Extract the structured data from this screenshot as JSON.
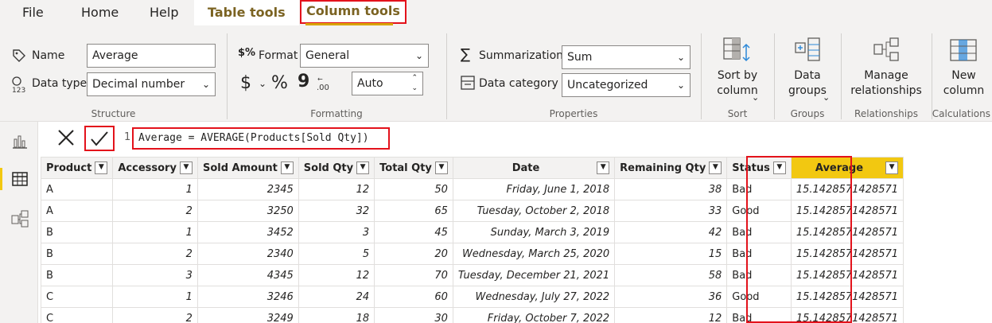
{
  "menu": {
    "file": "File",
    "home": "Home",
    "help": "Help",
    "table_tools": "Table tools",
    "column_tools": "Column tools"
  },
  "ribbon": {
    "structure": {
      "title": "Structure",
      "name_label": "Name",
      "name_value": "Average",
      "datatype_label": "Data type",
      "datatype_value": "Decimal number"
    },
    "formatting": {
      "title": "Formatting",
      "format_label": "Format",
      "format_value": "General",
      "currency_symbol": "$",
      "percent_symbol": "%",
      "comma_symbol": "9",
      "decimals_value": "Auto"
    },
    "properties": {
      "title": "Properties",
      "summarization_label": "Summarization",
      "summarization_value": "Sum",
      "category_label": "Data category",
      "category_value": "Uncategorized"
    },
    "sort": {
      "title": "Sort",
      "button": "Sort by\ncolumn"
    },
    "groups": {
      "title": "Groups",
      "button": "Data\ngroups"
    },
    "relationships": {
      "title": "Relationships",
      "button": "Manage\nrelationships"
    },
    "calculations": {
      "title": "Calculations",
      "button": "New\ncolumn"
    }
  },
  "formula": {
    "line_number": "1",
    "text": "Average = AVERAGE(Products[Sold Qty])"
  },
  "table": {
    "columns": [
      "Product",
      "Accessory",
      "Sold Amount",
      "Sold Qty",
      "Total Qty",
      "Date",
      "Remaining Qty",
      "Status",
      "Average"
    ],
    "rows": [
      [
        "A",
        "1",
        "2345",
        "12",
        "50",
        "Friday, June 1, 2018",
        "38",
        "Bad",
        "15.1428571428571"
      ],
      [
        "A",
        "2",
        "3250",
        "32",
        "65",
        "Tuesday, October 2, 2018",
        "33",
        "Good",
        "15.1428571428571"
      ],
      [
        "B",
        "1",
        "3452",
        "3",
        "45",
        "Sunday, March 3, 2019",
        "42",
        "Bad",
        "15.1428571428571"
      ],
      [
        "B",
        "2",
        "2340",
        "5",
        "20",
        "Wednesday, March 25, 2020",
        "15",
        "Bad",
        "15.1428571428571"
      ],
      [
        "B",
        "3",
        "4345",
        "12",
        "70",
        "Tuesday, December 21, 2021",
        "58",
        "Bad",
        "15.1428571428571"
      ],
      [
        "C",
        "1",
        "3246",
        "24",
        "60",
        "Wednesday, July 27, 2022",
        "36",
        "Good",
        "15.1428571428571"
      ],
      [
        "C",
        "2",
        "3249",
        "18",
        "30",
        "Friday, October 7, 2022",
        "12",
        "Bad",
        "15.1428571428571"
      ]
    ]
  },
  "colors": {
    "highlight_red": "#e3121b",
    "accent_yellow": "#f2c811",
    "context_tab": "#7b6322"
  }
}
